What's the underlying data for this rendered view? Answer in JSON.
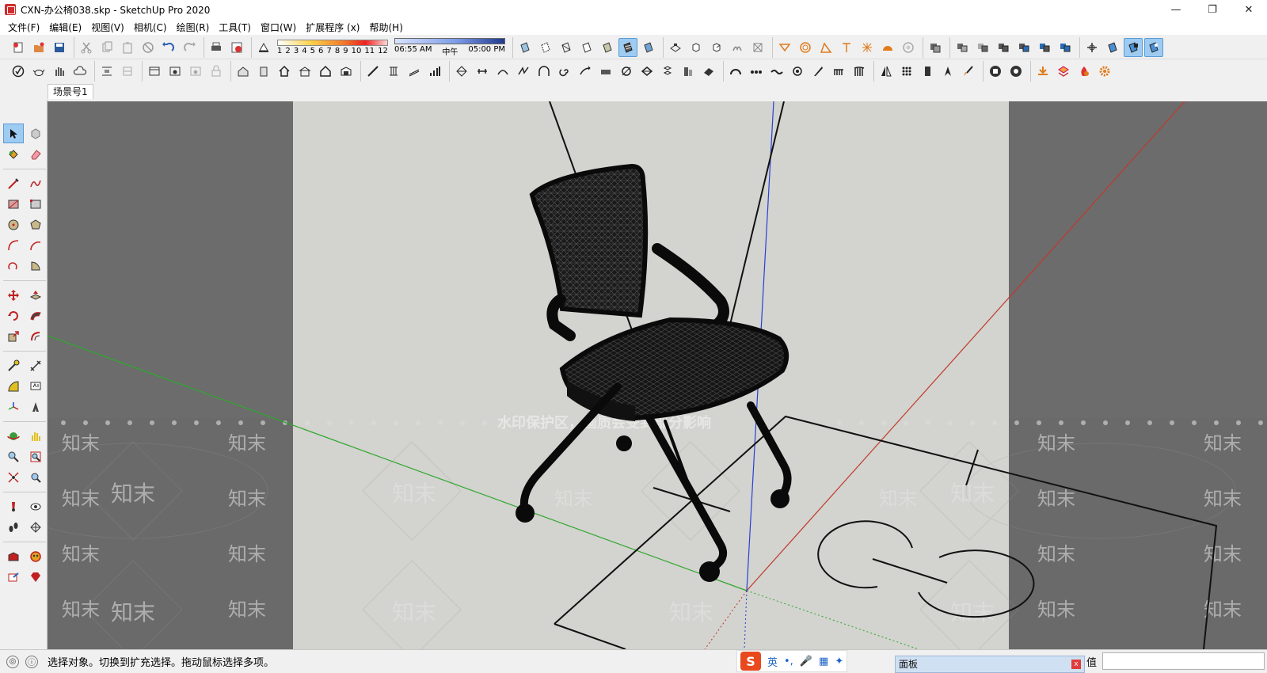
{
  "window": {
    "title": "CXN-办公椅038.skp - SketchUp Pro 2020",
    "minimize": "—",
    "restore": "❐",
    "close": "✕"
  },
  "menu": [
    "文件(F)",
    "编辑(E)",
    "视图(V)",
    "相机(C)",
    "绘图(R)",
    "工具(T)",
    "窗口(W)",
    "扩展程序 (x)",
    "帮助(H)"
  ],
  "shadow": {
    "numbers": [
      "1",
      "2",
      "3",
      "4",
      "5",
      "6",
      "7",
      "8",
      "9",
      "10",
      "11",
      "12"
    ]
  },
  "time": {
    "start": "06:55 AM",
    "noon": "中午",
    "end": "05:00 PM"
  },
  "scenes": {
    "tabs": [
      "场景号1"
    ]
  },
  "viewport": {
    "watermark_main": "水印保护区，画质会受到部分影响",
    "watermark_brand": "知末"
  },
  "status": {
    "hint": "选择对象。切换到扩充选择。拖动鼠标选择多项。",
    "value_label": "值"
  },
  "ime": {
    "logo": "S",
    "lang": "英",
    "punct": "•,",
    "mic": "🎤",
    "keyboard": "▦",
    "apps": "✦"
  },
  "tray": {
    "panel_label": "面板",
    "close": "x"
  },
  "colors": {
    "axis_red": "#c0392b",
    "axis_green": "#2ea82e",
    "axis_blue": "#2a3fd6",
    "background_sky": "#d6d6d2",
    "outer_gray": "#6c6c6c",
    "active_tool": "#9ecbf2"
  }
}
